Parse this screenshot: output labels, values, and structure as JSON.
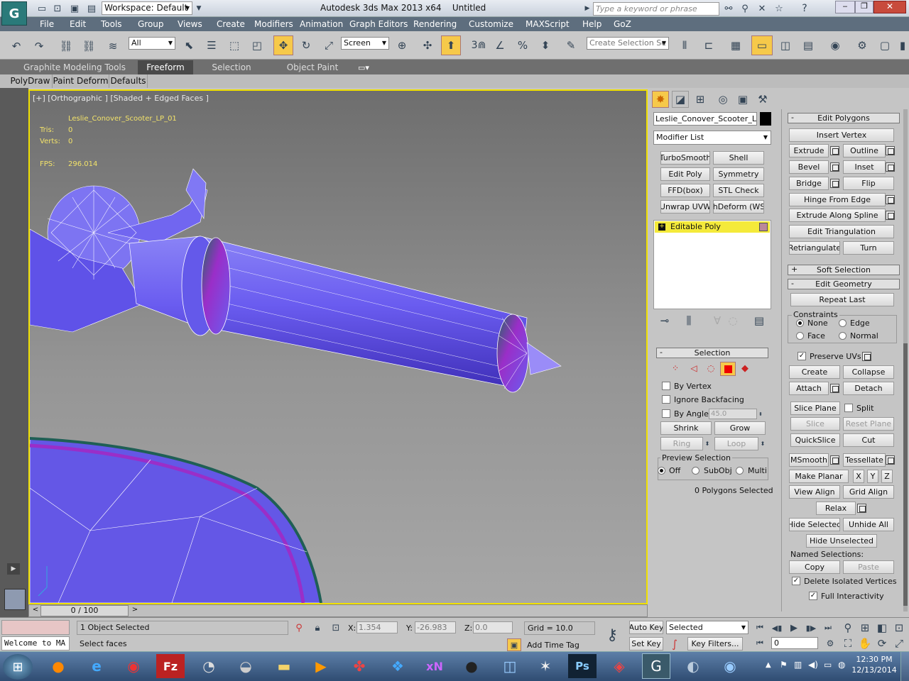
{
  "titlebar": {
    "workspace": "Workspace: Default",
    "title": "Autodesk 3ds Max  2013 x64",
    "file": "Untitled",
    "search_placeholder": "Type a keyword or phrase"
  },
  "menu": [
    "File",
    "Edit",
    "Tools",
    "Group",
    "Views",
    "Create",
    "Modifiers",
    "Animation",
    "Graph Editors",
    "Rendering",
    "Customize",
    "MAXScript",
    "Help",
    "GoZ"
  ],
  "toolbar": {
    "filter": "All",
    "ref_coord": "Screen",
    "named_selection": "Create Selection Se",
    "snap_num": "3"
  },
  "ribbon": {
    "tabs": [
      "Graphite Modeling Tools",
      "Freeform",
      "Selection",
      "Object Paint"
    ],
    "subtabs": [
      "PolyDraw",
      "Paint Deform",
      "Defaults"
    ]
  },
  "viewport": {
    "label": "[+] [Orthographic ] [Shaded + Edged Faces ]",
    "object_name": "Leslie_Conover_Scooter_LP_01",
    "stats": [
      {
        "k": "Tris:",
        "v": "0"
      },
      {
        "k": "Verts:",
        "v": "0"
      },
      {
        "k": "FPS:",
        "v": "296.014"
      }
    ]
  },
  "command_panel": {
    "object_name": "Leslie_Conover_Scooter_LP_(",
    "modifier_list": "Modifier List",
    "modifier_buttons": [
      "TurboSmooth",
      "Shell",
      "Edit Poly",
      "Symmetry",
      "FFD(box)",
      "STL Check",
      "Unwrap UVW",
      "thDeform (WSI"
    ],
    "stack_item": "Editable Poly",
    "selection": {
      "title": "Selection",
      "by_vertex": "By Vertex",
      "ignore_backfacing": "Ignore Backfacing",
      "by_angle": "By Angle:",
      "angle_value": "45.0",
      "shrink": "Shrink",
      "grow": "Grow",
      "ring": "Ring",
      "loop": "Loop",
      "preview_selection": "Preview Selection",
      "preview_options": [
        "Off",
        "SubObj",
        "Multi"
      ],
      "status": "0 Polygons Selected"
    }
  },
  "edit_polygons": {
    "title": "Edit Polygons",
    "insert_vertex": "Insert Vertex",
    "extrude": "Extrude",
    "outline": "Outline",
    "bevel": "Bevel",
    "inset": "Inset",
    "bridge": "Bridge",
    "flip": "Flip",
    "hinge_from_edge": "Hinge From Edge",
    "extrude_along_spline": "Extrude Along Spline",
    "edit_triangulation": "Edit Triangulation",
    "retriangulate": "Retriangulate",
    "turn": "Turn"
  },
  "soft_selection": {
    "title": "Soft Selection",
    "toggle": "+"
  },
  "edit_geometry": {
    "title": "Edit Geometry",
    "toggle": "-",
    "repeat_last": "Repeat Last",
    "constraints": "Constraints",
    "c_none": "None",
    "c_edge": "Edge",
    "c_face": "Face",
    "c_normal": "Normal",
    "preserve_uvs": "Preserve UVs",
    "create": "Create",
    "collapse": "Collapse",
    "attach": "Attach",
    "detach": "Detach",
    "slice_plane": "Slice Plane",
    "split": "Split",
    "slice": "Slice",
    "reset_plane": "Reset Plane",
    "quickslice": "QuickSlice",
    "cut": "Cut",
    "msmooth": "MSmooth",
    "tessellate": "Tessellate",
    "make_planar": "Make Planar",
    "x": "X",
    "y": "Y",
    "z": "Z",
    "view_align": "View Align",
    "grid_align": "Grid Align",
    "relax": "Relax",
    "hide_selected": "Hide Selected",
    "unhide_all": "Unhide All",
    "hide_unselected": "Hide Unselected",
    "named_selections": "Named Selections:",
    "copy": "Copy",
    "paste": "Paste",
    "delete_isolated": "Delete Isolated Vertices",
    "full_interactivity": "Full Interactivity"
  },
  "timeline": {
    "frame": "0 / 100"
  },
  "status": {
    "objects_selected": "1 Object Selected",
    "prompt": "Select faces",
    "x": "1.354",
    "y": "-26.983",
    "z": "0.0",
    "grid": "Grid = 10.0",
    "add_time_tag": "Add Time Tag",
    "auto_key": "Auto Key",
    "set_key": "Set Key",
    "selected": "Selected",
    "key_filters": "Key Filters...",
    "frame_field": "0",
    "maxscript": "Welcome to MA"
  },
  "taskbar": {
    "time": "12:30 PM",
    "date": "12/13/2014"
  }
}
